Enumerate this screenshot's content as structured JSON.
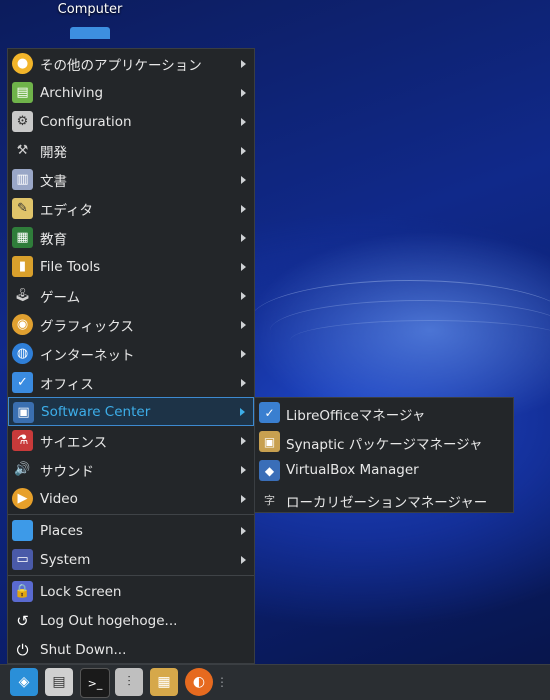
{
  "desktop": {
    "icon_label": "Computer"
  },
  "menu": {
    "items": [
      {
        "label": "その他のアプリケーション",
        "icon": "apps-icon",
        "color": "#f2b52a"
      },
      {
        "label": "Archiving",
        "icon": "archive-icon",
        "color": "#6fb34a"
      },
      {
        "label": "Configuration",
        "icon": "settings-icon",
        "color": "#c9c9c9"
      },
      {
        "label": "開発",
        "icon": "hammer-icon",
        "color": "#8a8a8a"
      },
      {
        "label": "文書",
        "icon": "book-icon",
        "color": "#9aa7c7"
      },
      {
        "label": "エディタ",
        "icon": "editor-icon",
        "color": "#e0c46a"
      },
      {
        "label": "教育",
        "icon": "chalkboard-icon",
        "color": "#2f7d3a"
      },
      {
        "label": "File Tools",
        "icon": "file-tools-icon",
        "color": "#d9a02c"
      },
      {
        "label": "ゲーム",
        "icon": "joystick-icon",
        "color": "#c9c9c9"
      },
      {
        "label": "グラフィックス",
        "icon": "palette-icon",
        "color": "#e0a030"
      },
      {
        "label": "インターネット",
        "icon": "globe-icon",
        "color": "#2f7fd8"
      },
      {
        "label": "オフィス",
        "icon": "office-icon",
        "color": "#3a8be0"
      },
      {
        "label": "Software Center",
        "icon": "software-center-icon",
        "color": "#3a6fb0"
      },
      {
        "label": "サイエンス",
        "icon": "science-icon",
        "color": "#c83a3a"
      },
      {
        "label": "サウンド",
        "icon": "speaker-icon",
        "color": "#c9a040"
      },
      {
        "label": "Video",
        "icon": "video-icon",
        "color": "#e7a02a"
      },
      {
        "label": "Places",
        "icon": "folder-icon",
        "color": "#3d9ae8"
      },
      {
        "label": "System",
        "icon": "monitor-icon",
        "color": "#4a5aa8"
      },
      {
        "label": "Lock Screen",
        "icon": "lock-screen-icon",
        "color": "#5a6ad0"
      },
      {
        "label": "Log Out hogehoge...",
        "icon": "logout-icon",
        "color": "#232629"
      },
      {
        "label": "Shut Down...",
        "icon": "power-icon",
        "color": "#232629"
      }
    ]
  },
  "submenu": {
    "items": [
      {
        "label": "LibreOfficeマネージャ",
        "icon": "libreoffice-icon",
        "color": "#3a7fd0"
      },
      {
        "label": "Synaptic パッケージマネージャ",
        "icon": "synaptic-icon",
        "color": "#c8a050"
      },
      {
        "label": "VirtualBox Manager",
        "icon": "virtualbox-icon",
        "color": "#3a6eb8"
      },
      {
        "label": "ローカリゼーションマネージャー",
        "icon": "localization-icon",
        "color": "#444444"
      }
    ]
  },
  "taskbar": {
    "items": [
      {
        "icon": "app-launcher-icon",
        "color": "#2a8fd8"
      },
      {
        "icon": "file-manager-icon",
        "color": "#d0d0d0"
      },
      {
        "icon": "terminal-icon",
        "color": "#1a1a1a"
      },
      {
        "icon": "mixer-icon",
        "color": "#bfbfbf"
      },
      {
        "icon": "package-icon",
        "color": "#d6a84a"
      },
      {
        "icon": "firefox-icon",
        "color": "#e66a1f"
      }
    ]
  }
}
